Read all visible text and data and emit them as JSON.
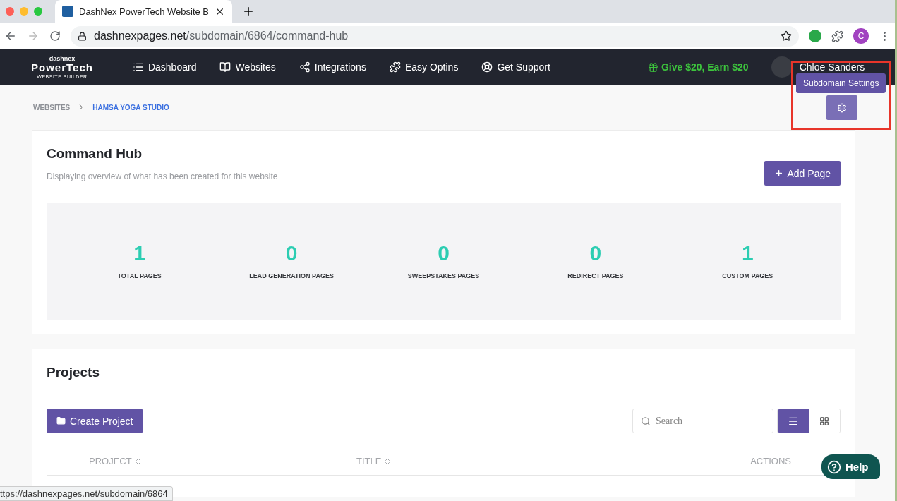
{
  "browser": {
    "tabs": [
      {
        "title": "DashNex PowerTech Website B",
        "selected": true
      }
    ],
    "url_host": "dashnexpages.net",
    "url_path": "/subdomain/6864/command-hub",
    "profile_initial": "C"
  },
  "navbar": {
    "logo": {
      "top": "dashnex",
      "main": "PowerTech",
      "sub": "WEBSITE BUILDER"
    },
    "items": [
      {
        "label": "Dashboard"
      },
      {
        "label": "Websites"
      },
      {
        "label": "Integrations"
      },
      {
        "label": "Easy Optins"
      },
      {
        "label": "Get Support"
      }
    ],
    "promo": "Give $20, Earn $20",
    "user": "Chloe Sanders"
  },
  "breadcrumb": [
    {
      "label": "WEBSITES",
      "selected": false
    },
    {
      "label": "HAMSA YOGA STUDIO",
      "selected": true
    }
  ],
  "settings_tooltip": "Subdomain Settings",
  "command_hub": {
    "title": "Command Hub",
    "subtitle": "Displaying overview of what has been created for this website",
    "add_button": "Add Page",
    "stats": [
      {
        "value": "1",
        "label": "TOTAL PAGES"
      },
      {
        "value": "0",
        "label": "LEAD GENERATION PAGES"
      },
      {
        "value": "0",
        "label": "SWEEPSTAKES PAGES"
      },
      {
        "value": "0",
        "label": "REDIRECT PAGES"
      },
      {
        "value": "1",
        "label": "CUSTOM PAGES"
      }
    ]
  },
  "projects": {
    "title": "Projects",
    "create_button": "Create Project",
    "search": {
      "placeholder": "Search"
    },
    "views": [
      {
        "kind": "list",
        "selected": true
      },
      {
        "kind": "grid",
        "selected": false
      }
    ],
    "columns": [
      {
        "label": "PROJECT",
        "sortable": true
      },
      {
        "label": "TITLE",
        "sortable": true
      },
      {
        "label": "ACTIONS",
        "sortable": false
      }
    ]
  },
  "status_url": "ttps://dashnexpages.net/subdomain/6864",
  "help_button": "Help"
}
